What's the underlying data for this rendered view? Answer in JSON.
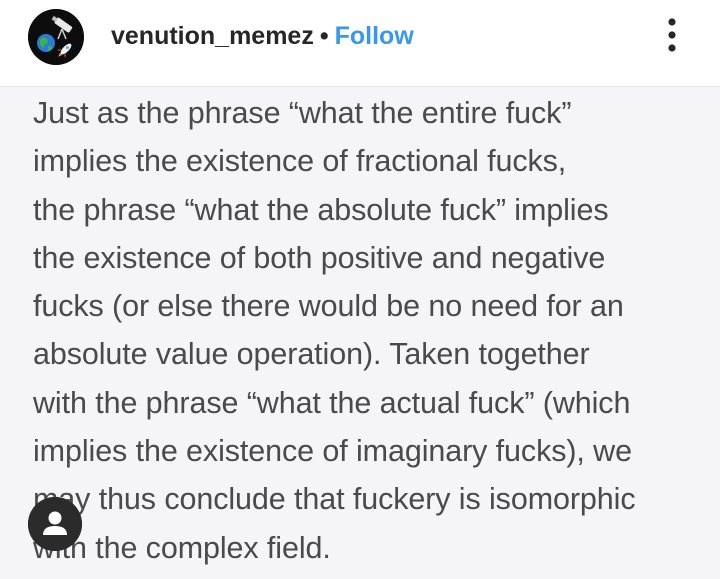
{
  "header": {
    "username": "venution_memez",
    "separator": "•",
    "follow_label": "Follow",
    "avatar_icon": "telescope-globe-rocket-avatar",
    "more_icon": "more-vertical-icon"
  },
  "post": {
    "lines": [
      "Just as the phrase “what the entire fuck”",
      "implies the existence of fractional fucks,",
      "the phrase “what the absolute fuck” implies",
      "the existence of both positive and negative",
      "fucks (or else there would be no need for an",
      "absolute value operation). Taken together",
      "with the phrase “what the actual fuck” (which",
      "implies the existence of imaginary fucks), we",
      "may thus conclude that fuckery is isomorphic",
      "with the complex field."
    ],
    "user_tag_icon": "user-tag-icon"
  },
  "colors": {
    "follow": "#3897f0",
    "text": "#262626",
    "post_background": "#f5f4f6",
    "post_text": "#4a4a4a"
  }
}
